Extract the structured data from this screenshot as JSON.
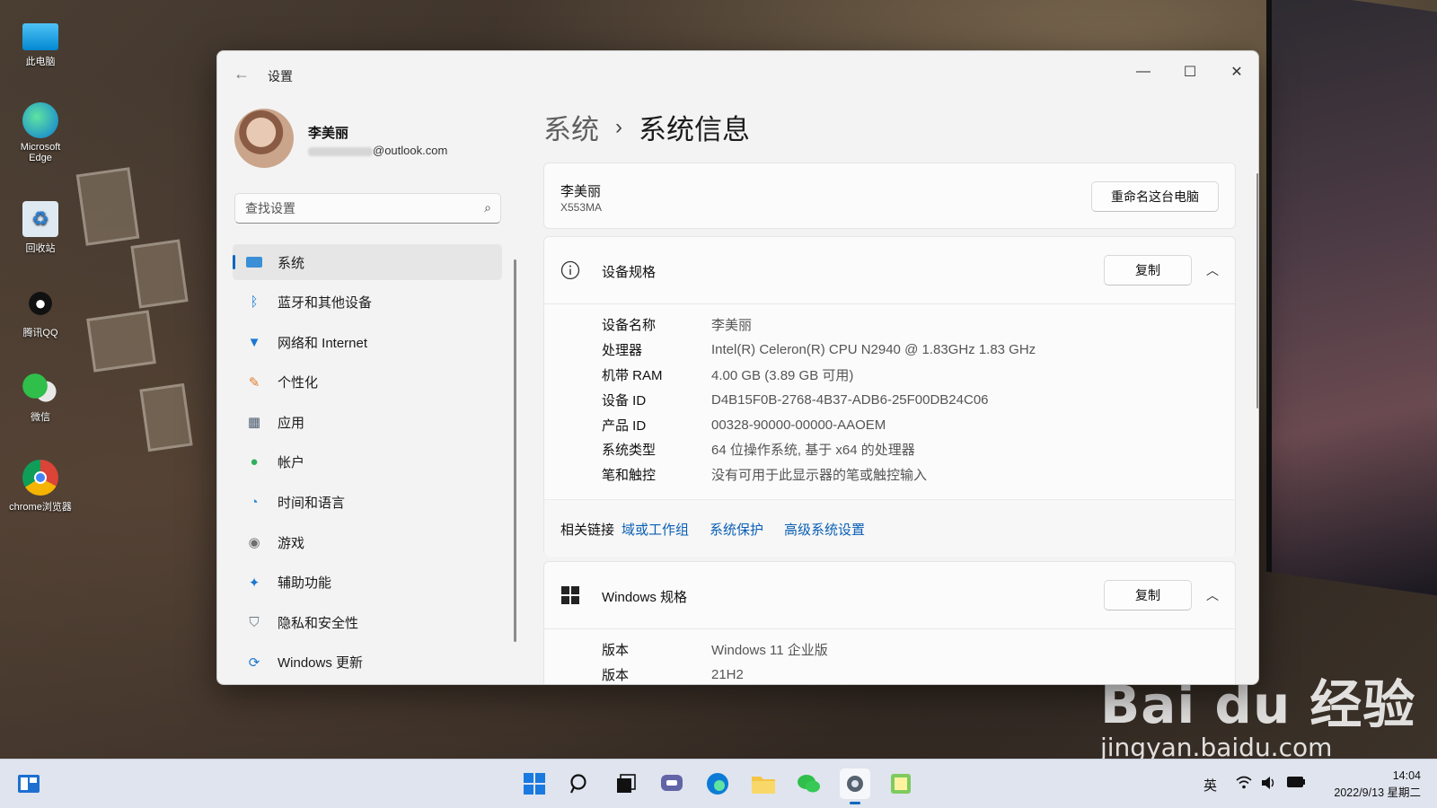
{
  "desktop": {
    "icons": [
      {
        "label": "此电脑",
        "icon": "computer-icon"
      },
      {
        "label": "Microsoft Edge",
        "icon": "edge-icon"
      },
      {
        "label": "回收站",
        "icon": "recycle-bin-icon"
      },
      {
        "label": "腾讯QQ",
        "icon": "qq-icon"
      },
      {
        "label": "微信",
        "icon": "wechat-icon"
      },
      {
        "label": "chrome浏览器",
        "icon": "chrome-icon"
      }
    ],
    "watermark": {
      "main": "Bai du 经验",
      "sub": "jingyan.baidu.com"
    }
  },
  "window": {
    "title": "设置",
    "controls": {
      "minimize": "—",
      "maximize": "☐",
      "close": "✕"
    }
  },
  "account": {
    "name": "李美丽",
    "email_suffix": "@outlook.com"
  },
  "search": {
    "placeholder": "查找设置"
  },
  "nav": [
    {
      "label": "系统",
      "icon": "system-icon",
      "active": true
    },
    {
      "label": "蓝牙和其他设备",
      "icon": "bluetooth-icon"
    },
    {
      "label": "网络和 Internet",
      "icon": "wifi-icon"
    },
    {
      "label": "个性化",
      "icon": "brush-icon"
    },
    {
      "label": "应用",
      "icon": "apps-icon"
    },
    {
      "label": "帐户",
      "icon": "account-icon"
    },
    {
      "label": "时间和语言",
      "icon": "globe-clock-icon"
    },
    {
      "label": "游戏",
      "icon": "gamepad-icon"
    },
    {
      "label": "辅助功能",
      "icon": "accessibility-icon"
    },
    {
      "label": "隐私和安全性",
      "icon": "shield-icon"
    },
    {
      "label": "Windows 更新",
      "icon": "update-icon"
    }
  ],
  "breadcrumb": {
    "parent": "系统",
    "separator": "›",
    "current": "系统信息"
  },
  "pc": {
    "name": "李美丽",
    "model": "X553MA",
    "rename_label": "重命名这台电脑"
  },
  "device_specs": {
    "title": "设备规格",
    "copy_label": "复制",
    "rows": [
      {
        "key": "设备名称",
        "value": "李美丽"
      },
      {
        "key": "处理器",
        "value": "Intel(R) Celeron(R) CPU  N2940  @ 1.83GHz   1.83 GHz"
      },
      {
        "key": "机带 RAM",
        "value": "4.00 GB (3.89 GB 可用)"
      },
      {
        "key": "设备 ID",
        "value": "D4B15F0B-2768-4B37-ADB6-25F00DB24C06"
      },
      {
        "key": "产品 ID",
        "value": "00328-90000-00000-AAOEM"
      },
      {
        "key": "系统类型",
        "value": "64 位操作系统, 基于 x64 的处理器"
      },
      {
        "key": "笔和触控",
        "value": "没有可用于此显示器的笔或触控输入"
      }
    ]
  },
  "related": {
    "label": "相关链接",
    "links": [
      "域或工作组",
      "系统保护",
      "高级系统设置"
    ]
  },
  "windows_specs": {
    "title": "Windows 规格",
    "copy_label": "复制",
    "rows": [
      {
        "key": "版本",
        "value": "Windows 11 企业版"
      },
      {
        "key": "版本",
        "value": "21H2"
      }
    ]
  },
  "taskbar": {
    "input_method": "英",
    "time": "14:04",
    "date": "2022/9/13 星期二"
  },
  "colors": {
    "accent": "#0067c0",
    "link": "#0a5fb4"
  }
}
